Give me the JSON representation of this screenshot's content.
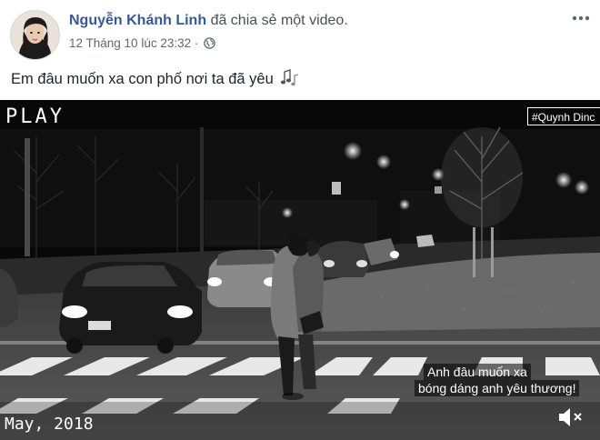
{
  "post": {
    "author": "Nguyễn Khánh Linh",
    "action": "đã chia sẻ một video.",
    "timestamp": "12 Tháng 10 lúc 23:32",
    "separator": "·",
    "privacy_icon": "globe-icon",
    "more_icon": "ellipsis-icon",
    "caption": "Em đâu muốn xa con phố nơi ta đã yêu",
    "caption_emoji": "music-notes-icon"
  },
  "video": {
    "overlay_title": "PLAY",
    "watermark": "#Quynh Dinc",
    "subtitle_lines": [
      "Anh đâu muốn xa",
      "bóng dáng anh yêu thương!"
    ],
    "date_stamp": "May, 2018",
    "sound_icon": "speaker-muted-icon"
  }
}
